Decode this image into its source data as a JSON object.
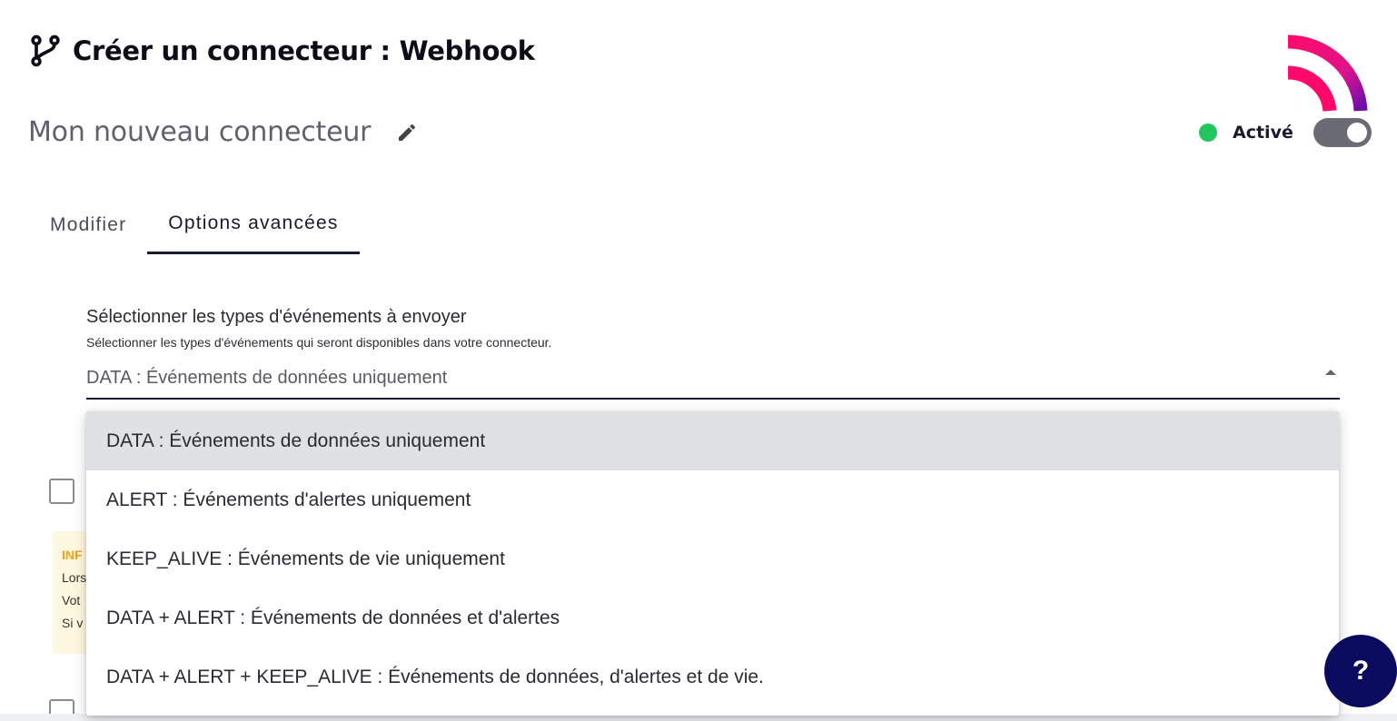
{
  "header": {
    "title": "Créer un connecteur : Webhook",
    "icon": "git-branch-icon"
  },
  "connector": {
    "name": "Mon nouveau connecteur",
    "edit_icon": "pencil-icon"
  },
  "status": {
    "label": "Activé",
    "dot_color": "#22c55e",
    "enabled": true
  },
  "tabs": [
    {
      "label": "Modifier",
      "active": false
    },
    {
      "label": "Options avancées",
      "active": true
    }
  ],
  "event_types": {
    "label": "Sélectionner les types d'événements à envoyer",
    "help": "Sélectionner les types d'événements qui seront disponibles dans votre connecteur.",
    "value": "DATA : Événements de données uniquement",
    "options": [
      "DATA : Événements de données uniquement",
      "ALERT : Événements d'alertes uniquement",
      "KEEP_ALIVE : Événements de vie uniquement",
      "DATA + ALERT : Événements de données et d'alertes",
      "DATA + ALERT + KEEP_ALIVE : Événements de données, d'alertes et de vie."
    ],
    "selected_index": 0
  },
  "info_box": {
    "title": "INF",
    "lines": [
      "Lors",
      "Vot",
      "Si v"
    ]
  },
  "help_button": {
    "icon": "question-icon",
    "glyph": "?"
  },
  "colors": {
    "primary_dark": "#0a0a5e",
    "logo_gradient_start": "#ff0a6c",
    "logo_gradient_end": "#6a0dad",
    "info_accent": "#f4a11b"
  }
}
